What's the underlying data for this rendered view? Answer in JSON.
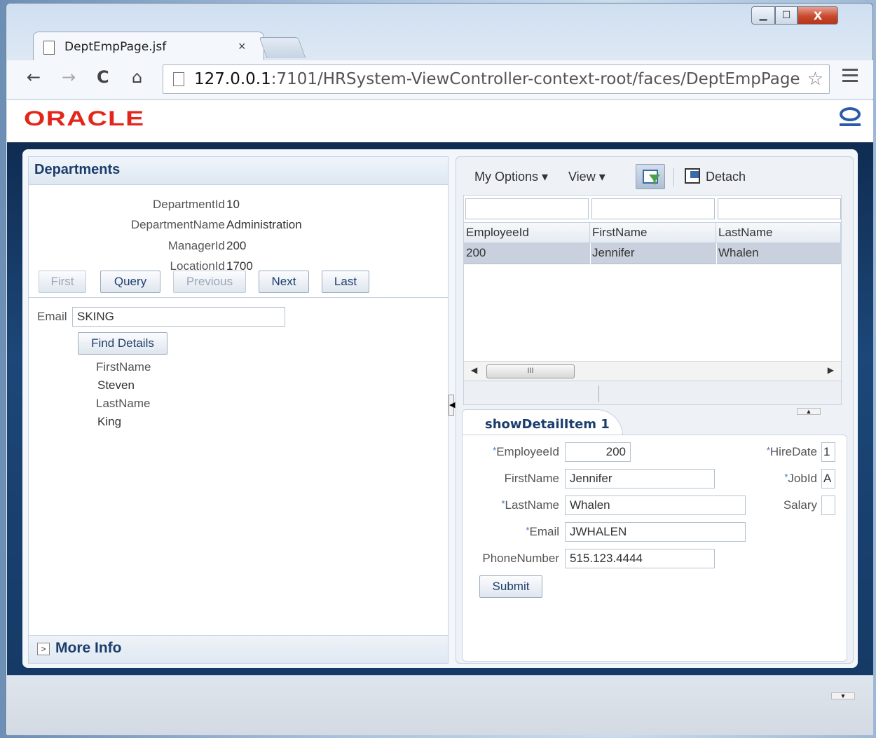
{
  "browser": {
    "tab_title": "DeptEmpPage.jsf",
    "url_host": "127.0.0.1",
    "url_rest": ":7101/HRSystem-ViewController-context-root/faces/DeptEmpPage",
    "window_controls": {
      "minimize": "▁",
      "maximize": "☐",
      "close": "X"
    },
    "tab_close": "×"
  },
  "brand": {
    "logo_text": "ORACLE"
  },
  "departments": {
    "header": "Departments",
    "fields": [
      {
        "label": "DepartmentId",
        "value": "10"
      },
      {
        "label": "DepartmentName",
        "value": "Administration"
      },
      {
        "label": "ManagerId",
        "value": "200"
      },
      {
        "label": "LocationId",
        "value": "1700"
      }
    ],
    "buttons": {
      "first": "First",
      "query": "Query",
      "previous": "Previous",
      "next": "Next",
      "last": "Last"
    },
    "email_label": "Email",
    "email_value": "SKING",
    "find_button": "Find Details",
    "details": {
      "first_label": "FirstName",
      "first_value": "Steven",
      "last_label": "LastName",
      "last_value": "King"
    },
    "more_info": "More Info"
  },
  "employees_table": {
    "toolbar": {
      "my_options": "My Options",
      "view": "View",
      "detach": "Detach"
    },
    "columns": [
      "EmployeeId",
      "FirstName",
      "LastName"
    ],
    "rows": [
      [
        "200",
        "Jennifer",
        "Whalen"
      ]
    ],
    "scroll_thumb": "III"
  },
  "detail_form": {
    "tab_label": "showDetailItem 1",
    "employee_id_label": "EmployeeId",
    "employee_id_value": "200",
    "first_name_label": "FirstName",
    "first_name_value": "Jennifer",
    "last_name_label": "LastName",
    "last_name_value": "Whalen",
    "email_label": "Email",
    "email_value": "JWHALEN",
    "phone_label": "PhoneNumber",
    "phone_value": "515.123.4444",
    "hire_date_label": "HireDate",
    "hire_date_value": "1",
    "job_id_label": "JobId",
    "job_id_value": "A",
    "salary_label": "Salary",
    "salary_value": "",
    "required_marker": "*",
    "submit": "Submit"
  }
}
